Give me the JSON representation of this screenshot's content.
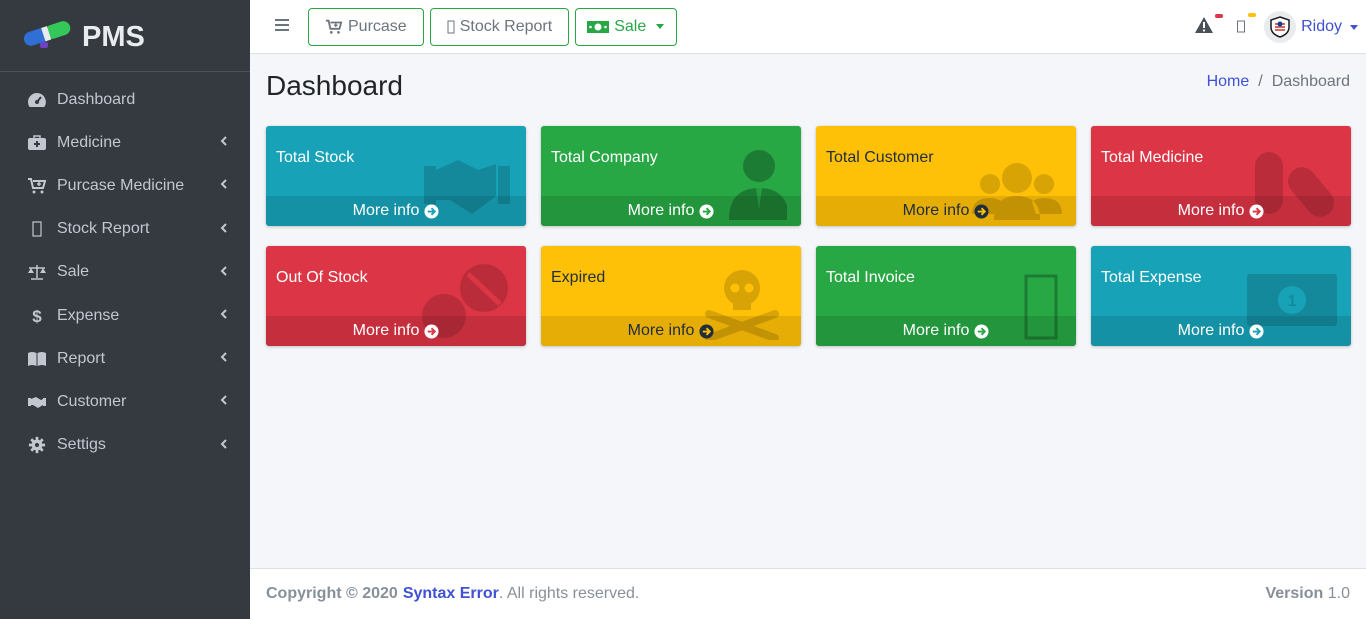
{
  "brand": {
    "name": "PMS"
  },
  "sidebar": {
    "items": [
      {
        "label": "Dashboard",
        "icon": "tachometer-icon",
        "chevron": false
      },
      {
        "label": "Medicine",
        "icon": "medkit-icon",
        "chevron": true
      },
      {
        "label": "Purcase Medicine",
        "icon": "cart-plus-icon",
        "chevron": true
      },
      {
        "label": "Stock Report",
        "icon": "missing-glyph-icon",
        "chevron": true
      },
      {
        "label": "Sale",
        "icon": "balance-scale-icon",
        "chevron": true
      },
      {
        "label": "Expense",
        "icon": "dollar-icon",
        "chevron": true
      },
      {
        "label": "Report",
        "icon": "book-open-icon",
        "chevron": true
      },
      {
        "label": "Customer",
        "icon": "handshake-icon",
        "chevron": true
      },
      {
        "label": "Settigs",
        "icon": "gear-icon",
        "chevron": true
      }
    ]
  },
  "topbar": {
    "purcase_label": "Purcase",
    "stock_report_label": "Stock Report",
    "sale_label": "Sale",
    "user_name": "Ridoy",
    "notification_color_1": "#dc3545",
    "notification_color_2": "#ffc107"
  },
  "header": {
    "title": "Dashboard",
    "breadcrumb": {
      "home": "Home",
      "current": "Dashboard"
    }
  },
  "boxes": [
    {
      "title": "Total Stock",
      "footer": "More info",
      "color": "#17a2b8",
      "text": "white",
      "icon": "handshake-icon"
    },
    {
      "title": "Total Company",
      "footer": "More info",
      "color": "#28a745",
      "text": "white",
      "icon": "user-tie-icon"
    },
    {
      "title": "Total Customer",
      "footer": "More info",
      "color": "#ffc107",
      "text": "dark",
      "icon": "users-icon"
    },
    {
      "title": "Total Medicine",
      "footer": "More info",
      "color": "#dc3545",
      "text": "white",
      "icon": "capsules-icon"
    },
    {
      "title": "Out Of Stock",
      "footer": "More info",
      "color": "#dc3545",
      "text": "white",
      "icon": "pills-icon"
    },
    {
      "title": "Expired",
      "footer": "More info",
      "color": "#ffc107",
      "text": "dark",
      "icon": "skull-crossbones-icon"
    },
    {
      "title": "Total Invoice",
      "footer": "More info",
      "color": "#28a745",
      "text": "white",
      "icon": "missing-glyph-icon"
    },
    {
      "title": "Total Expense",
      "footer": "More info",
      "color": "#17a2b8",
      "text": "white",
      "icon": "money-bill-icon"
    }
  ],
  "footer": {
    "copyright": "Copyright © 2020",
    "company": "Syntax Error",
    "rights": ". All rights reserved.",
    "version_label": "Version",
    "version": "1.0"
  }
}
